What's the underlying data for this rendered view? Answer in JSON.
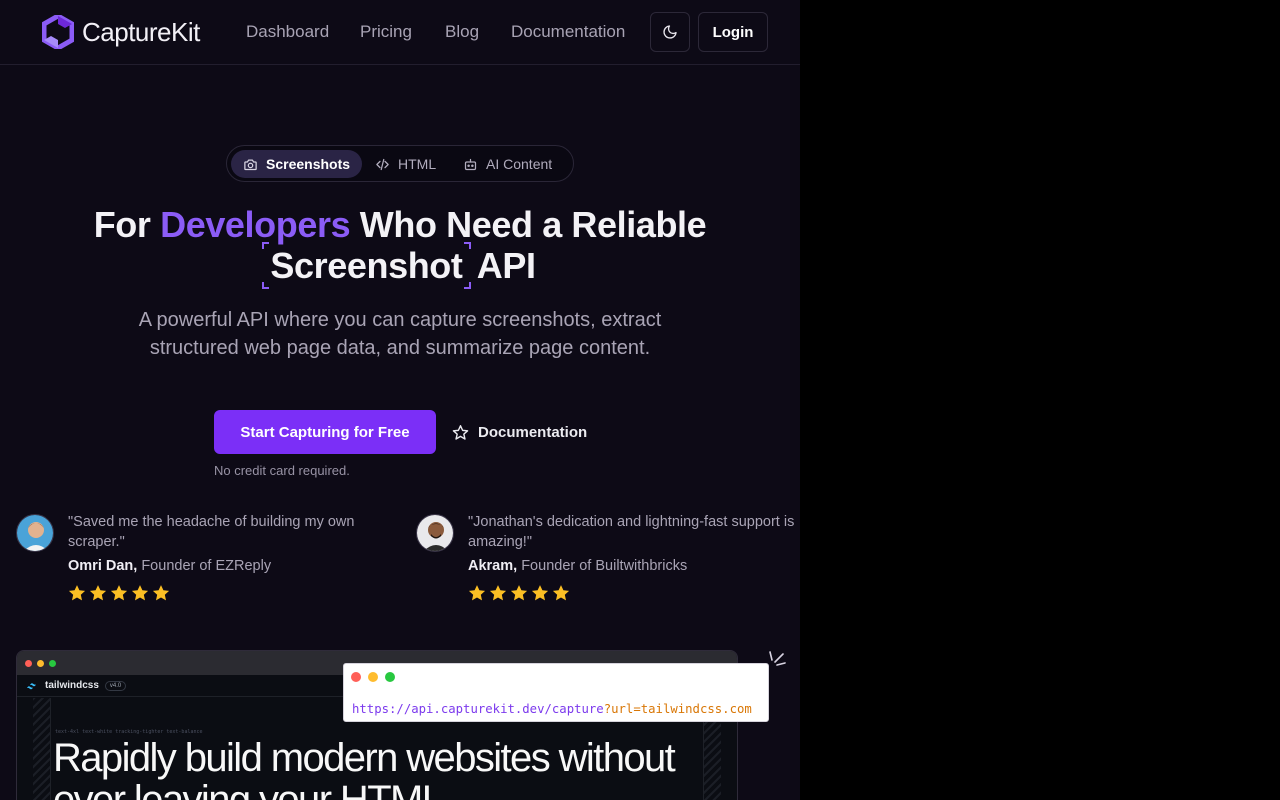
{
  "brand": {
    "name": "CaptureKit",
    "color": "#8b5cf6"
  },
  "nav": {
    "links": [
      "Dashboard",
      "Pricing",
      "Blog",
      "Documentation"
    ],
    "theme_icon": "moon-icon",
    "login_label": "Login"
  },
  "tabs": [
    {
      "label": "Screenshots",
      "icon": "camera-icon",
      "active": true
    },
    {
      "label": "HTML",
      "icon": "code-icon",
      "active": false
    },
    {
      "label": "AI Content",
      "icon": "bot-icon",
      "active": false
    }
  ],
  "hero": {
    "headline_part1": "For ",
    "headline_accent": "Developers",
    "headline_part2": " Who Need a Reliable",
    "headline_bracketed": "Screenshot",
    "headline_part3": " API",
    "subtitle": "A powerful API where you can capture screenshots, extract structured web page data, and summarize page content.",
    "cta_label": "Start Capturing for Free",
    "cta_color": "#7b2ff7",
    "docs_label": "Documentation",
    "note": "No credit card required."
  },
  "testimonials": [
    {
      "quote": "\"Saved me the headache of building my own scraper.\"",
      "name": "Omri Dan,",
      "role": "Founder of EZReply",
      "rating": 5
    },
    {
      "quote": "\"Jonathan's dedication and lightning-fast support is amazing!\"",
      "name": "Akram,",
      "role": "Founder of Builtwithbricks",
      "rating": 5
    }
  ],
  "preview": {
    "site_name": "tailwindcss",
    "version": "v4.0",
    "tiny_text": "text-4xl text-white tracking-tighter text-balance",
    "headline": "Rapidly build modern websites without ever leaving your HTML"
  },
  "api_card": {
    "url_base": "https://api.capturekit.dev/capture",
    "url_query": "?url=tailwindcss.com"
  }
}
